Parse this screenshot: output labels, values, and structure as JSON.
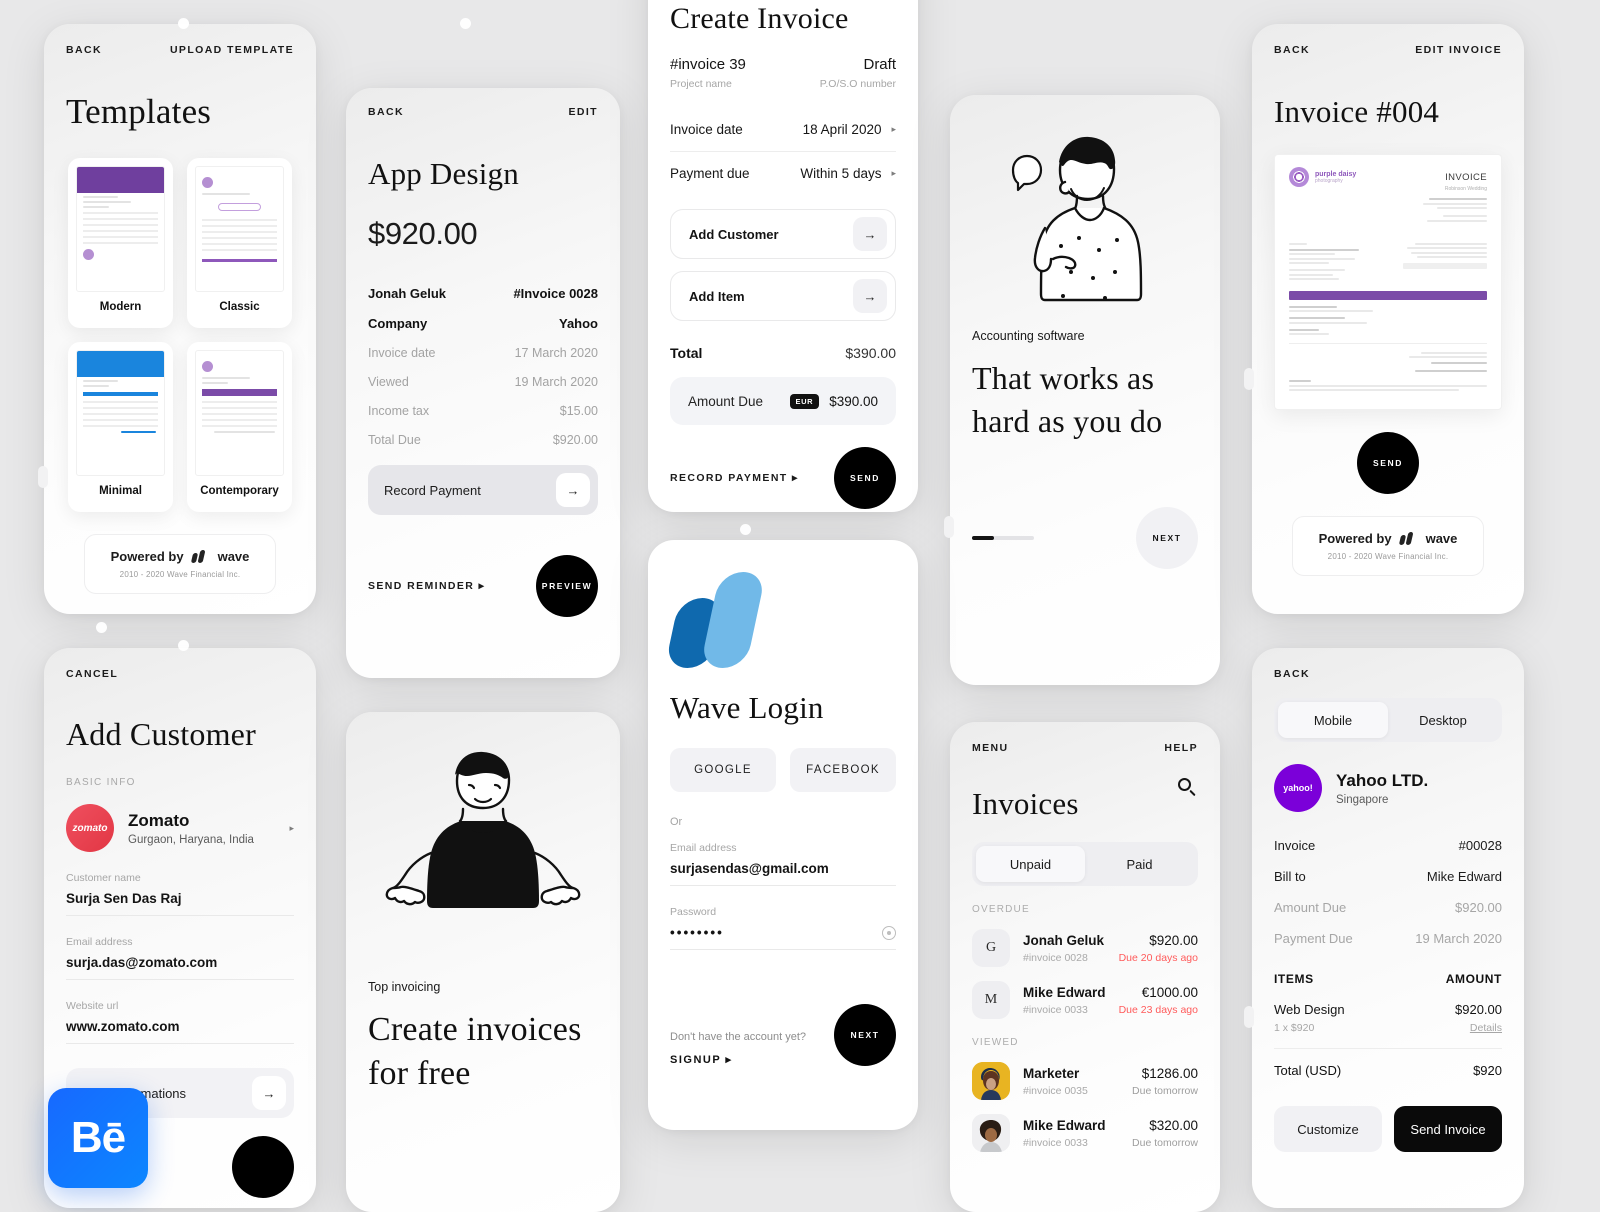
{
  "templates_screen": {
    "back": "BACK",
    "upload": "UPLOAD TEMPLATE",
    "title": "Templates",
    "cards": [
      {
        "name": "Modern"
      },
      {
        "name": "Classic"
      },
      {
        "name": "Minimal"
      },
      {
        "name": "Contemporary"
      }
    ],
    "powered_by": "Powered by",
    "brand": "wave",
    "copyright": "2010 - 2020 Wave Financial Inc."
  },
  "app_design_screen": {
    "back": "BACK",
    "edit": "EDIT",
    "title": "App Design",
    "amount": "$920.00",
    "rows": [
      {
        "label": "Jonah Geluk",
        "value": "#Invoice 0028",
        "dim": false
      },
      {
        "label": "Company",
        "value": "Yahoo",
        "dim": false
      },
      {
        "label": "Invoice date",
        "value": "17 March 2020",
        "dim": true
      },
      {
        "label": "Viewed",
        "value": "19 March 2020",
        "dim": true
      },
      {
        "label": "Income tax",
        "value": "$15.00",
        "dim": true
      },
      {
        "label": "Total Due",
        "value": "$920.00",
        "dim": true
      }
    ],
    "record_payment": "Record Payment",
    "arrow": "→",
    "send_reminder": "SEND REMINDER",
    "send_reminder_caret": "▸",
    "preview": "PREVIEW"
  },
  "create_invoice_screen": {
    "title": "Create Invoice",
    "invoice_no": "#invoice 39",
    "status": "Draft",
    "project_name": "Project name",
    "po_number": "P.O/S.O number",
    "invoice_date_label": "Invoice date",
    "invoice_date_value": "18 April 2020",
    "payment_due_label": "Payment due",
    "payment_due_value": "Within 5 days",
    "caret": "▸",
    "add_customer": "Add Customer",
    "add_item": "Add Item",
    "arrow": "→",
    "total_label": "Total",
    "total_value": "$390.00",
    "amount_due_label": "Amount Due",
    "currency_chip": "EUR",
    "amount_due_value": "$390.00",
    "record_payment": "RECORD PAYMENT",
    "send": "SEND"
  },
  "accounting_screen": {
    "eyebrow": "Accounting software",
    "headline": "That works as hard as you do",
    "next": "NEXT"
  },
  "invoice004_screen": {
    "back": "BACK",
    "edit_invoice": "EDIT INVOICE",
    "title": "Invoice #004",
    "send": "SEND",
    "powered_by": "Powered by",
    "brand": "wave",
    "copyright": "2010 - 2020 Wave Financial Inc.",
    "preview": {
      "brand_name": "purple daisy",
      "brand_sub": "photography",
      "doc_title": "INVOICE",
      "doc_sub": "Robinson Wedding"
    }
  },
  "add_customer_screen": {
    "cancel": "CANCEL",
    "title": "Add Customer",
    "section": "BASIC INFO",
    "company_logo_text": "zomato",
    "company_name": "Zomato",
    "company_location": "Gurgaon, Haryana, India",
    "caret": "▸",
    "fields": [
      {
        "label": "Customer name",
        "value": "Surja Sen Das Raj"
      },
      {
        "label": "Email address",
        "value": "surja.das@zomato.com"
      },
      {
        "label": "Website url",
        "value": "www.zomato.com"
      }
    ],
    "more_button": "More informations",
    "arrow": "→",
    "behance_badge": "Bē"
  },
  "free_invoices_screen": {
    "eyebrow": "Top invoicing",
    "headline": "Create invoices for free"
  },
  "login_screen": {
    "title": "Wave Login",
    "google": "GOOGLE",
    "facebook": "FACEBOOK",
    "or": "Or",
    "email_label": "Email address",
    "email_value": "surjasendas@gmail.com",
    "password_label": "Password",
    "password_value": "••••••••",
    "no_account": "Don't have the account yet?",
    "signup": "SIGNUP",
    "signup_caret": "▸",
    "next": "NEXT"
  },
  "invoices_screen": {
    "menu": "MENU",
    "help": "HELP",
    "title": "Invoices",
    "tabs": [
      {
        "label": "Unpaid",
        "active": true
      },
      {
        "label": "Paid",
        "active": false
      }
    ],
    "groups": [
      {
        "label": "OVERDUE",
        "items": [
          {
            "avatar": "G",
            "avatar_kind": "letter",
            "name": "Jonah Geluk",
            "invoice": "#invoice 0028",
            "amount": "$920.00",
            "due": "Due 20 days ago",
            "overdue": true
          },
          {
            "avatar": "M",
            "avatar_kind": "letter",
            "name": "Mike Edward",
            "invoice": "#invoice 0033",
            "amount": "€1000.00",
            "due": "Due 23 days ago",
            "overdue": true
          }
        ]
      },
      {
        "label": "VIEWED",
        "items": [
          {
            "avatar": "",
            "avatar_kind": "photo-yellow",
            "name": "Marketer",
            "invoice": "#invoice 0035",
            "amount": "$1286.00",
            "due": "Due tomorrow",
            "overdue": false
          },
          {
            "avatar": "",
            "avatar_kind": "photo-grey",
            "name": "Mike Edward",
            "invoice": "#invoice 0033",
            "amount": "$320.00",
            "due": "Due tomorrow",
            "overdue": false
          }
        ]
      }
    ]
  },
  "yahoo_invoice_screen": {
    "back": "BACK",
    "tabs": [
      {
        "label": "Mobile",
        "active": true
      },
      {
        "label": "Desktop",
        "active": false
      }
    ],
    "logo_text": "yahoo!",
    "company": "Yahoo LTD.",
    "location": "Singapore",
    "rows": [
      {
        "label": "Invoice",
        "value": "#00028",
        "dim": false
      },
      {
        "label": "Bill to",
        "value": "Mike Edward",
        "dim": false
      },
      {
        "label": "Amount Due",
        "value": "$920.00",
        "dim": true
      },
      {
        "label": "Payment Due",
        "value": "19 March 2020",
        "dim": true
      }
    ],
    "items_header": {
      "left": "ITEMS",
      "right": "AMOUNT"
    },
    "items": [
      {
        "name": "Web Design",
        "qty": "1 x $920",
        "amount": "$920.00",
        "details": "Details"
      }
    ],
    "total_label": "Total (USD)",
    "total_value": "$920",
    "customize": "Customize",
    "send_invoice": "Send Invoice"
  },
  "colors": {
    "background": "#e8e8e9",
    "accent_dark": "#0a0a0a",
    "wave_blue_dark": "#0f69ae",
    "wave_blue_light": "#71b9e8",
    "purple": "#7b4ba8",
    "yahoo_purple": "#7b00d9",
    "zomato_red": "#e23744",
    "overdue_red": "#ff5b5b",
    "behance_blue": "#1769ff"
  }
}
